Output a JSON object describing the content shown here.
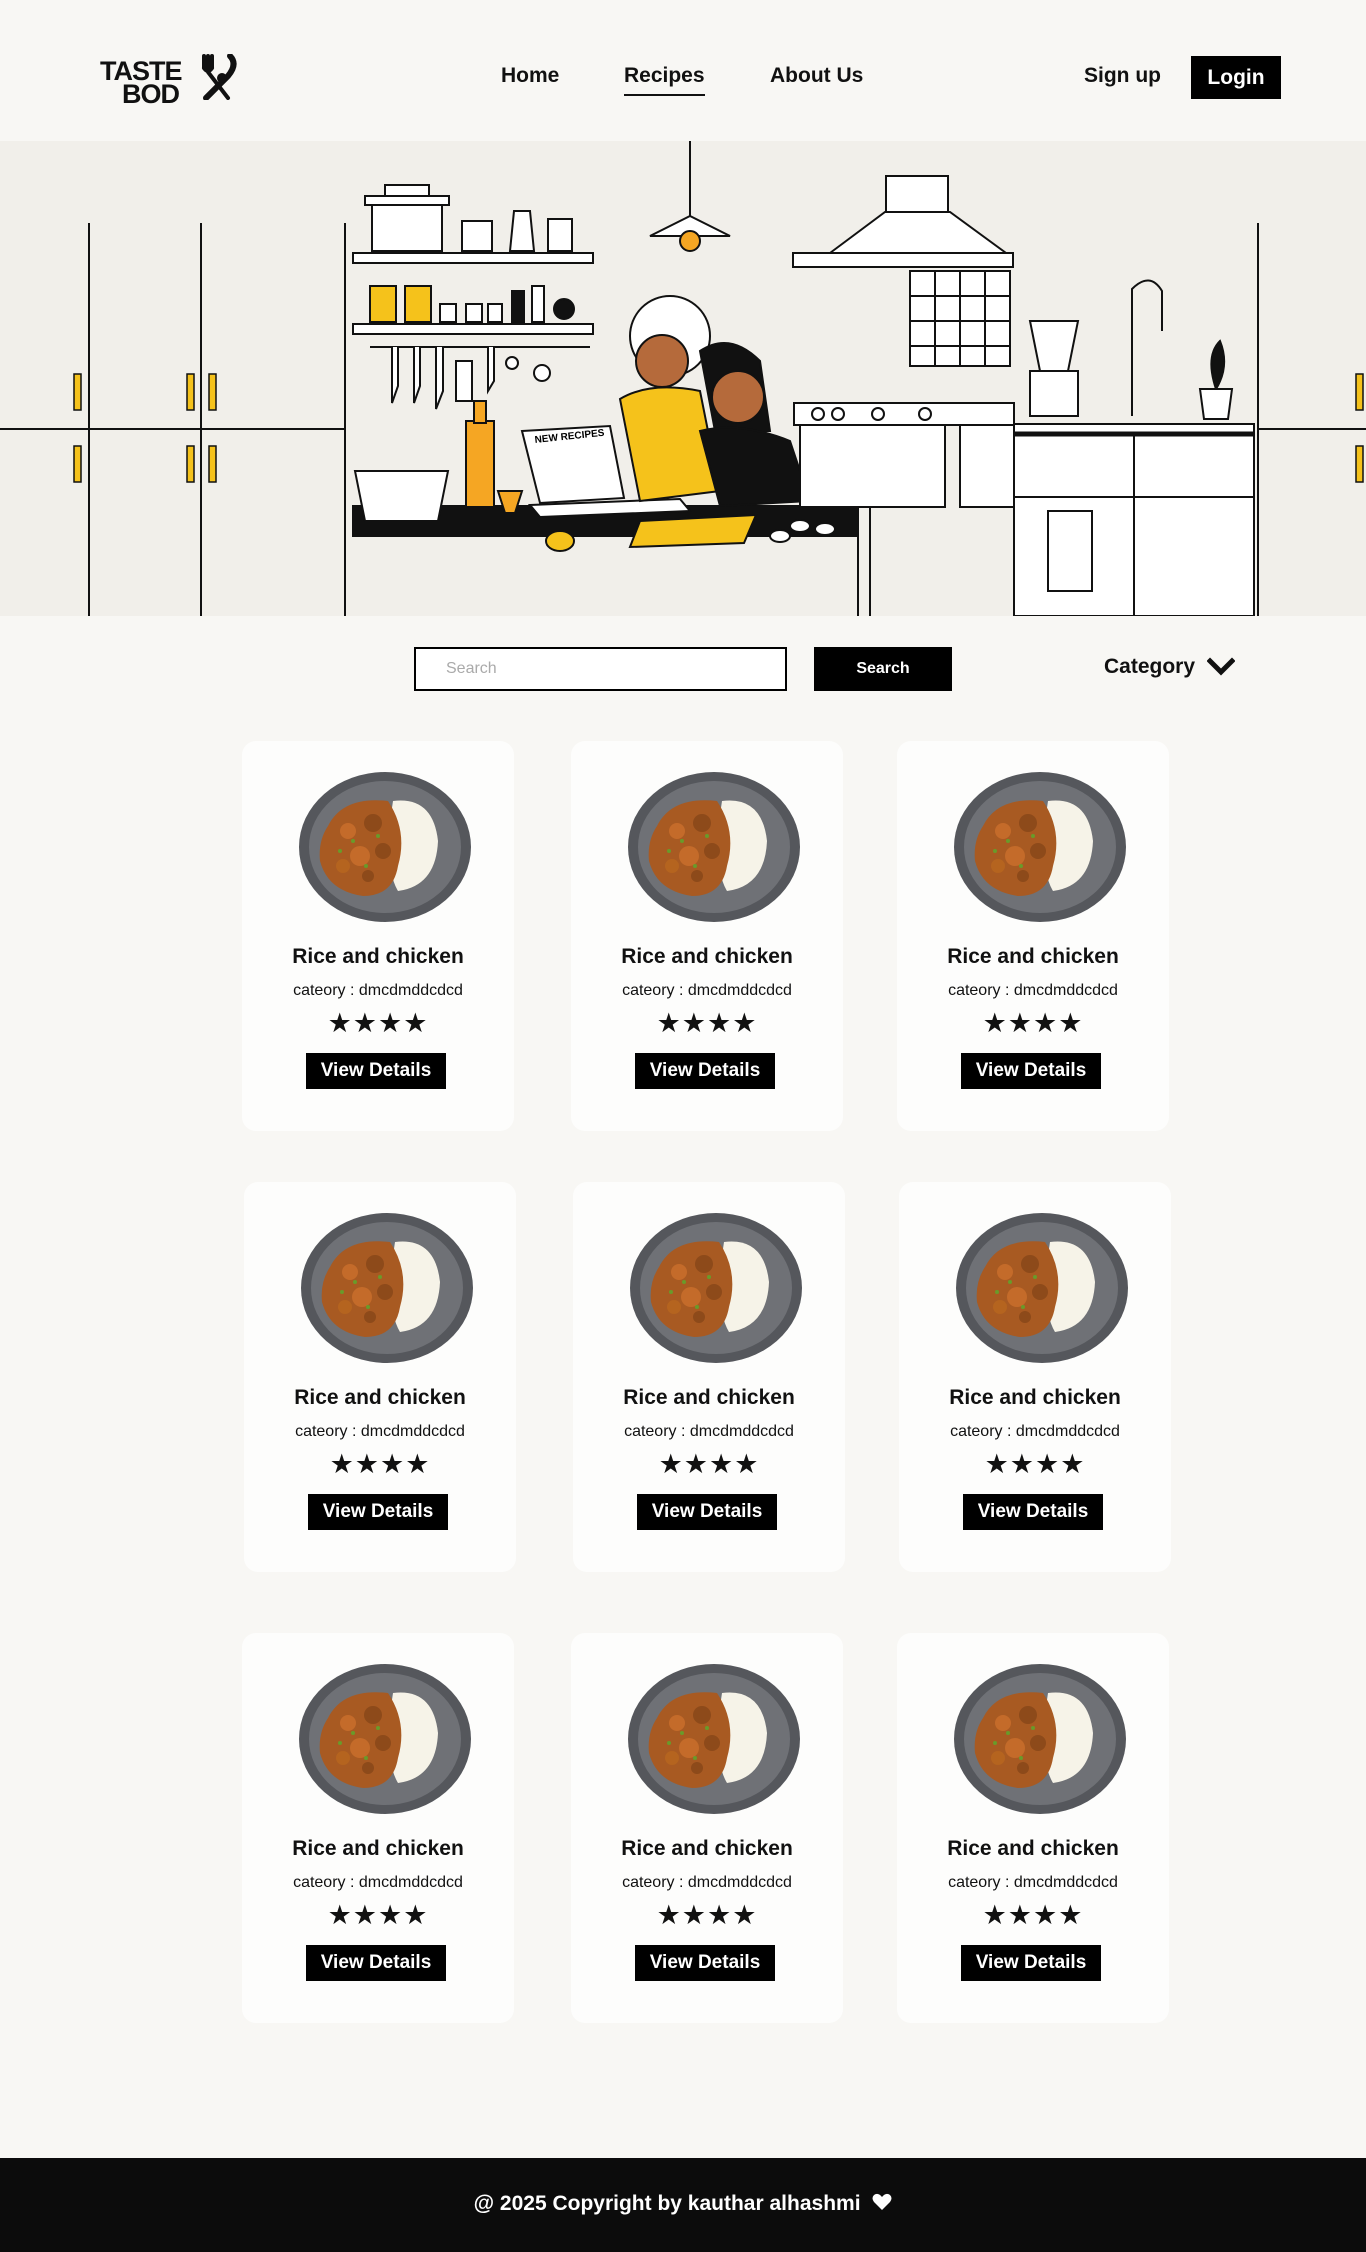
{
  "header": {
    "logo_line1": "TASTE",
    "logo_line2": "BOD",
    "nav": {
      "home": "Home",
      "recipes": "Recipes",
      "about": "About Us"
    },
    "signup": "Sign up",
    "login": "Login"
  },
  "hero": {
    "laptop_label": "NEW RECIPES"
  },
  "search": {
    "placeholder": "Search",
    "value": "",
    "button": "Search",
    "category_label": "Category"
  },
  "recipes": [
    {
      "title": "Rice and chicken",
      "category": "cateory : dmcdmddcdcd",
      "rating": 4,
      "button": "View Details"
    },
    {
      "title": "Rice and chicken",
      "category": "cateory : dmcdmddcdcd",
      "rating": 4,
      "button": "View Details"
    },
    {
      "title": "Rice and chicken",
      "category": "cateory : dmcdmddcdcd",
      "rating": 4,
      "button": "View Details"
    },
    {
      "title": "Rice and chicken",
      "category": "cateory : dmcdmddcdcd",
      "rating": 4,
      "button": "View Details"
    },
    {
      "title": "Rice and chicken",
      "category": "cateory : dmcdmddcdcd",
      "rating": 4,
      "button": "View Details"
    },
    {
      "title": "Rice and chicken",
      "category": "cateory : dmcdmddcdcd",
      "rating": 4,
      "button": "View Details"
    },
    {
      "title": "Rice and chicken",
      "category": "cateory : dmcdmddcdcd",
      "rating": 4,
      "button": "View Details"
    },
    {
      "title": "Rice and chicken",
      "category": "cateory : dmcdmddcdcd",
      "rating": 4,
      "button": "View Details"
    },
    {
      "title": "Rice and chicken",
      "category": "cateory : dmcdmddcdcd",
      "rating": 4,
      "button": "View Details"
    }
  ],
  "footer": {
    "copyright": "@ 2025 Copyright by kauthar alhashmi"
  },
  "colors": {
    "accent": "#f5c21b",
    "dark": "#000000",
    "background": "#f8f7f4",
    "footer": "#0c0c0c"
  },
  "icons": {
    "category_toggle": "chevron-down-icon",
    "footer_heart": "heart-icon",
    "logo_mark": "fork-knife-icon"
  }
}
